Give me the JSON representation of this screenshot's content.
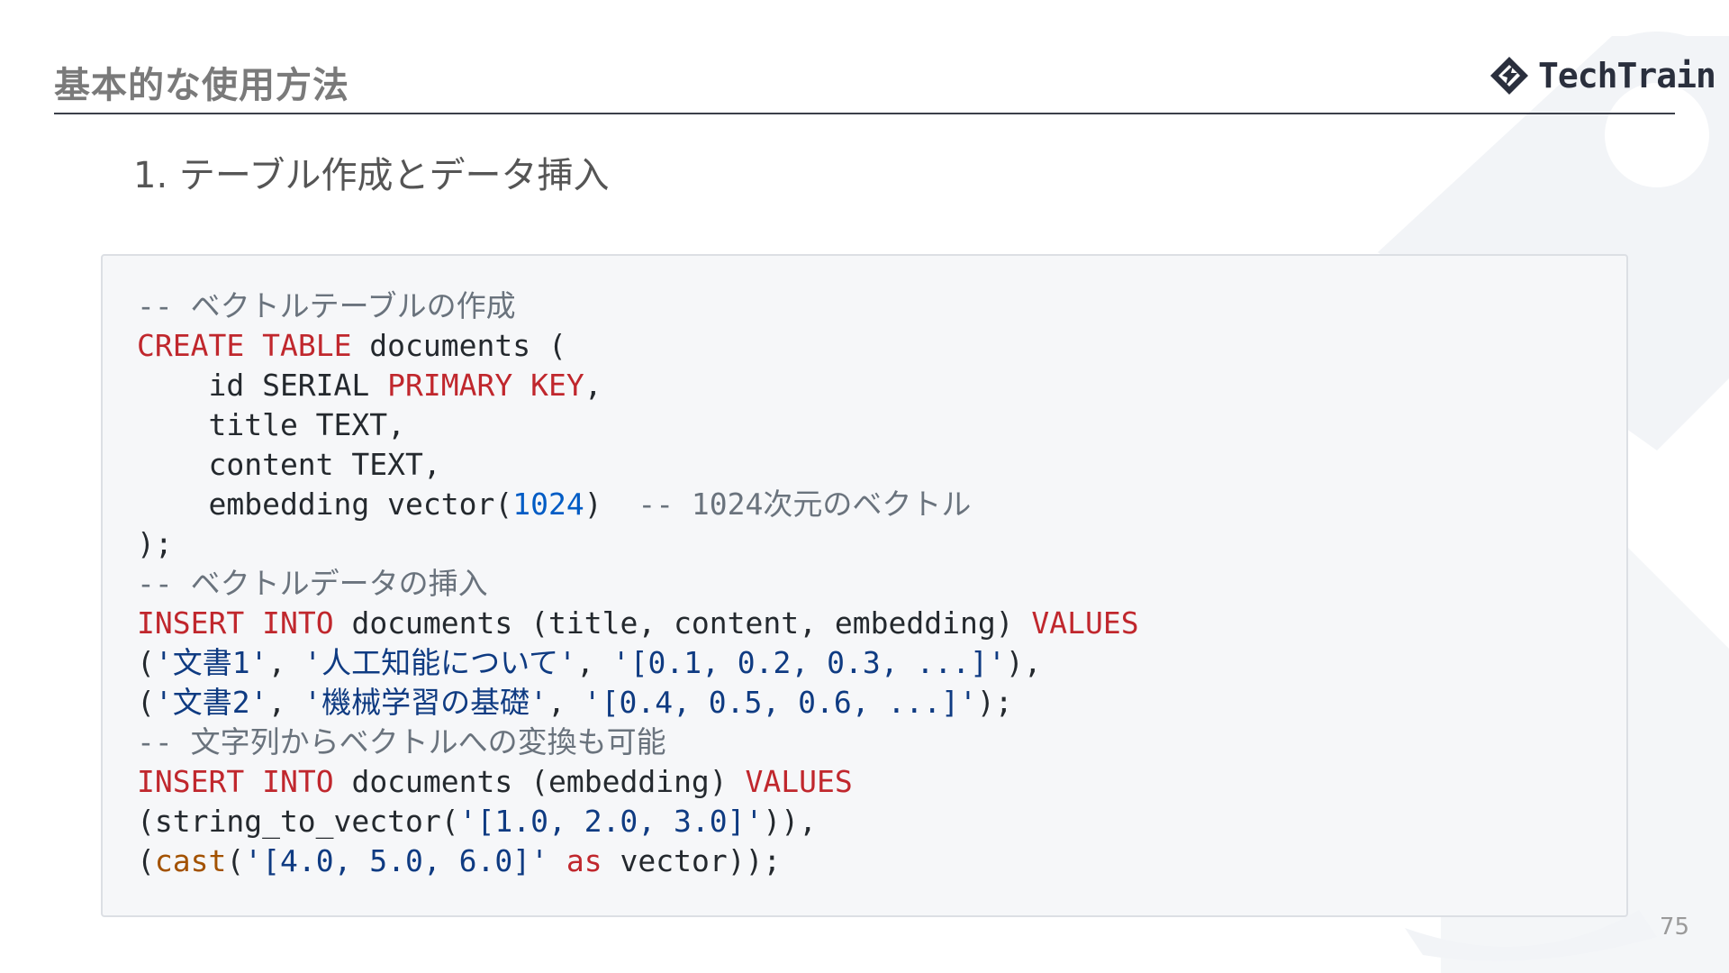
{
  "slide": {
    "title": "基本的な使用方法",
    "subtitle": "1. テーブル作成とデータ挿入",
    "page_number": "75"
  },
  "logo": {
    "text": "TechTrain",
    "icon": "techtrain-diamond-logo-icon"
  },
  "colors": {
    "comment": "#6a737d",
    "keyword": "#c0272d",
    "number": "#005cc5",
    "string": "#0f3b82",
    "function": "#a35200",
    "plain": "#24292e",
    "code_background": "#f6f7f9"
  },
  "code": {
    "language": "sql",
    "lines": [
      [
        {
          "t": "c",
          "v": "-- ベクトルテーブルの作成"
        }
      ],
      [
        {
          "t": "k",
          "v": "CREATE"
        },
        {
          "t": "p",
          "v": " "
        },
        {
          "t": "k",
          "v": "TABLE"
        },
        {
          "t": "p",
          "v": " documents ("
        }
      ],
      [
        {
          "t": "p",
          "v": "    id SERIAL "
        },
        {
          "t": "k",
          "v": "PRIMARY"
        },
        {
          "t": "p",
          "v": " "
        },
        {
          "t": "k",
          "v": "KEY"
        },
        {
          "t": "p",
          "v": ","
        }
      ],
      [
        {
          "t": "p",
          "v": "    title TEXT,"
        }
      ],
      [
        {
          "t": "p",
          "v": "    content TEXT,"
        }
      ],
      [
        {
          "t": "p",
          "v": "    embedding vector("
        },
        {
          "t": "n",
          "v": "1024"
        },
        {
          "t": "p",
          "v": ")  "
        },
        {
          "t": "c",
          "v": "-- 1024次元のベクトル"
        }
      ],
      [
        {
          "t": "p",
          "v": ");"
        }
      ],
      [
        {
          "t": "c",
          "v": "-- ベクトルデータの挿入"
        }
      ],
      [
        {
          "t": "k",
          "v": "INSERT"
        },
        {
          "t": "p",
          "v": " "
        },
        {
          "t": "k",
          "v": "INTO"
        },
        {
          "t": "p",
          "v": " documents (title, content, embedding) "
        },
        {
          "t": "k",
          "v": "VALUES"
        }
      ],
      [
        {
          "t": "p",
          "v": "("
        },
        {
          "t": "s",
          "v": "'文書1'"
        },
        {
          "t": "p",
          "v": ", "
        },
        {
          "t": "s",
          "v": "'人工知能について'"
        },
        {
          "t": "p",
          "v": ", "
        },
        {
          "t": "s",
          "v": "'[0.1, 0.2, 0.3, ...]'"
        },
        {
          "t": "p",
          "v": "),"
        }
      ],
      [
        {
          "t": "p",
          "v": "("
        },
        {
          "t": "s",
          "v": "'文書2'"
        },
        {
          "t": "p",
          "v": ", "
        },
        {
          "t": "s",
          "v": "'機械学習の基礎'"
        },
        {
          "t": "p",
          "v": ", "
        },
        {
          "t": "s",
          "v": "'[0.4, 0.5, 0.6, ...]'"
        },
        {
          "t": "p",
          "v": ");"
        }
      ],
      [
        {
          "t": "c",
          "v": "-- 文字列からベクトルへの変換も可能"
        }
      ],
      [
        {
          "t": "k",
          "v": "INSERT"
        },
        {
          "t": "p",
          "v": " "
        },
        {
          "t": "k",
          "v": "INTO"
        },
        {
          "t": "p",
          "v": " documents (embedding) "
        },
        {
          "t": "k",
          "v": "VALUES"
        }
      ],
      [
        {
          "t": "p",
          "v": "(string_to_vector("
        },
        {
          "t": "s",
          "v": "'[1.0, 2.0, 3.0]'"
        },
        {
          "t": "p",
          "v": ")),"
        }
      ],
      [
        {
          "t": "p",
          "v": "("
        },
        {
          "t": "f",
          "v": "cast"
        },
        {
          "t": "p",
          "v": "("
        },
        {
          "t": "s",
          "v": "'[4.0, 5.0, 6.0]'"
        },
        {
          "t": "p",
          "v": " "
        },
        {
          "t": "k",
          "v": "as"
        },
        {
          "t": "p",
          "v": " vector));"
        }
      ]
    ]
  }
}
